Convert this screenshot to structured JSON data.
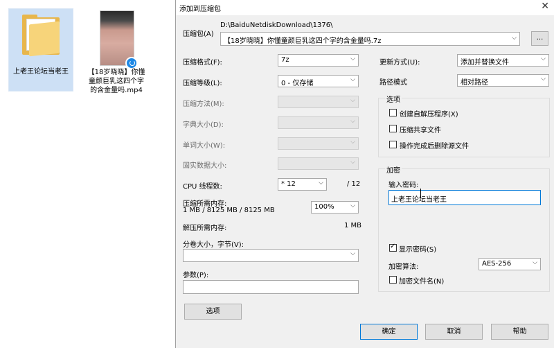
{
  "desktop": {
    "folder_label": "上老王论坛当老王",
    "video_label": "【18岁晓晓】你懂童颜巨乳这四个字的含金量吗.mp4"
  },
  "dialog": {
    "title": "添加到压缩包",
    "archive_label": "压缩包(A)",
    "archive_path": "D:\\BaiduNetdiskDownload\\1376\\",
    "archive_name": "【18岁晓晓】你懂童颜巨乳这四个字的含金量吗.7z",
    "browse_label": "...",
    "format_label": "压缩格式(F):",
    "format_value": "7z",
    "level_label": "压缩等级(L):",
    "level_value": "0 - 仅存储",
    "method_label": "压缩方法(M):",
    "dict_label": "字典大小(D):",
    "word_label": "单词大小(W):",
    "solid_label": "固实数据大小:",
    "cpu_label": "CPU 线程数:",
    "cpu_value": "* 12",
    "cpu_total": "/ 12",
    "mem_comp_label": "压缩所需内存:",
    "mem_comp_value": "1 MB / 8125 MB / 8125 MB",
    "mem_percent": "100%",
    "mem_decomp_label": "解压所需内存:",
    "mem_decomp_value": "1 MB",
    "volume_label": "分卷大小，字节(V):",
    "volume_value": "",
    "params_label": "参数(P):",
    "params_value": "",
    "options_button": "选项",
    "update_label": "更新方式(U):",
    "update_value": "添加并替换文件",
    "path_label": "路径模式",
    "path_value": "相对路径",
    "options_group": "选项",
    "opt_sfx": "创建自解压程序(X)",
    "opt_shared": "压缩共享文件",
    "opt_delete": "操作完成后删除源文件",
    "encrypt_group": "加密",
    "password_label": "输入密码:",
    "password_value": "上老王论坛当老王",
    "show_password": "显示密码(S)",
    "enc_method_label": "加密算法:",
    "enc_method_value": "AES-256",
    "encrypt_names": "加密文件名(N)",
    "ok": "确定",
    "cancel": "取消",
    "help": "帮助"
  }
}
